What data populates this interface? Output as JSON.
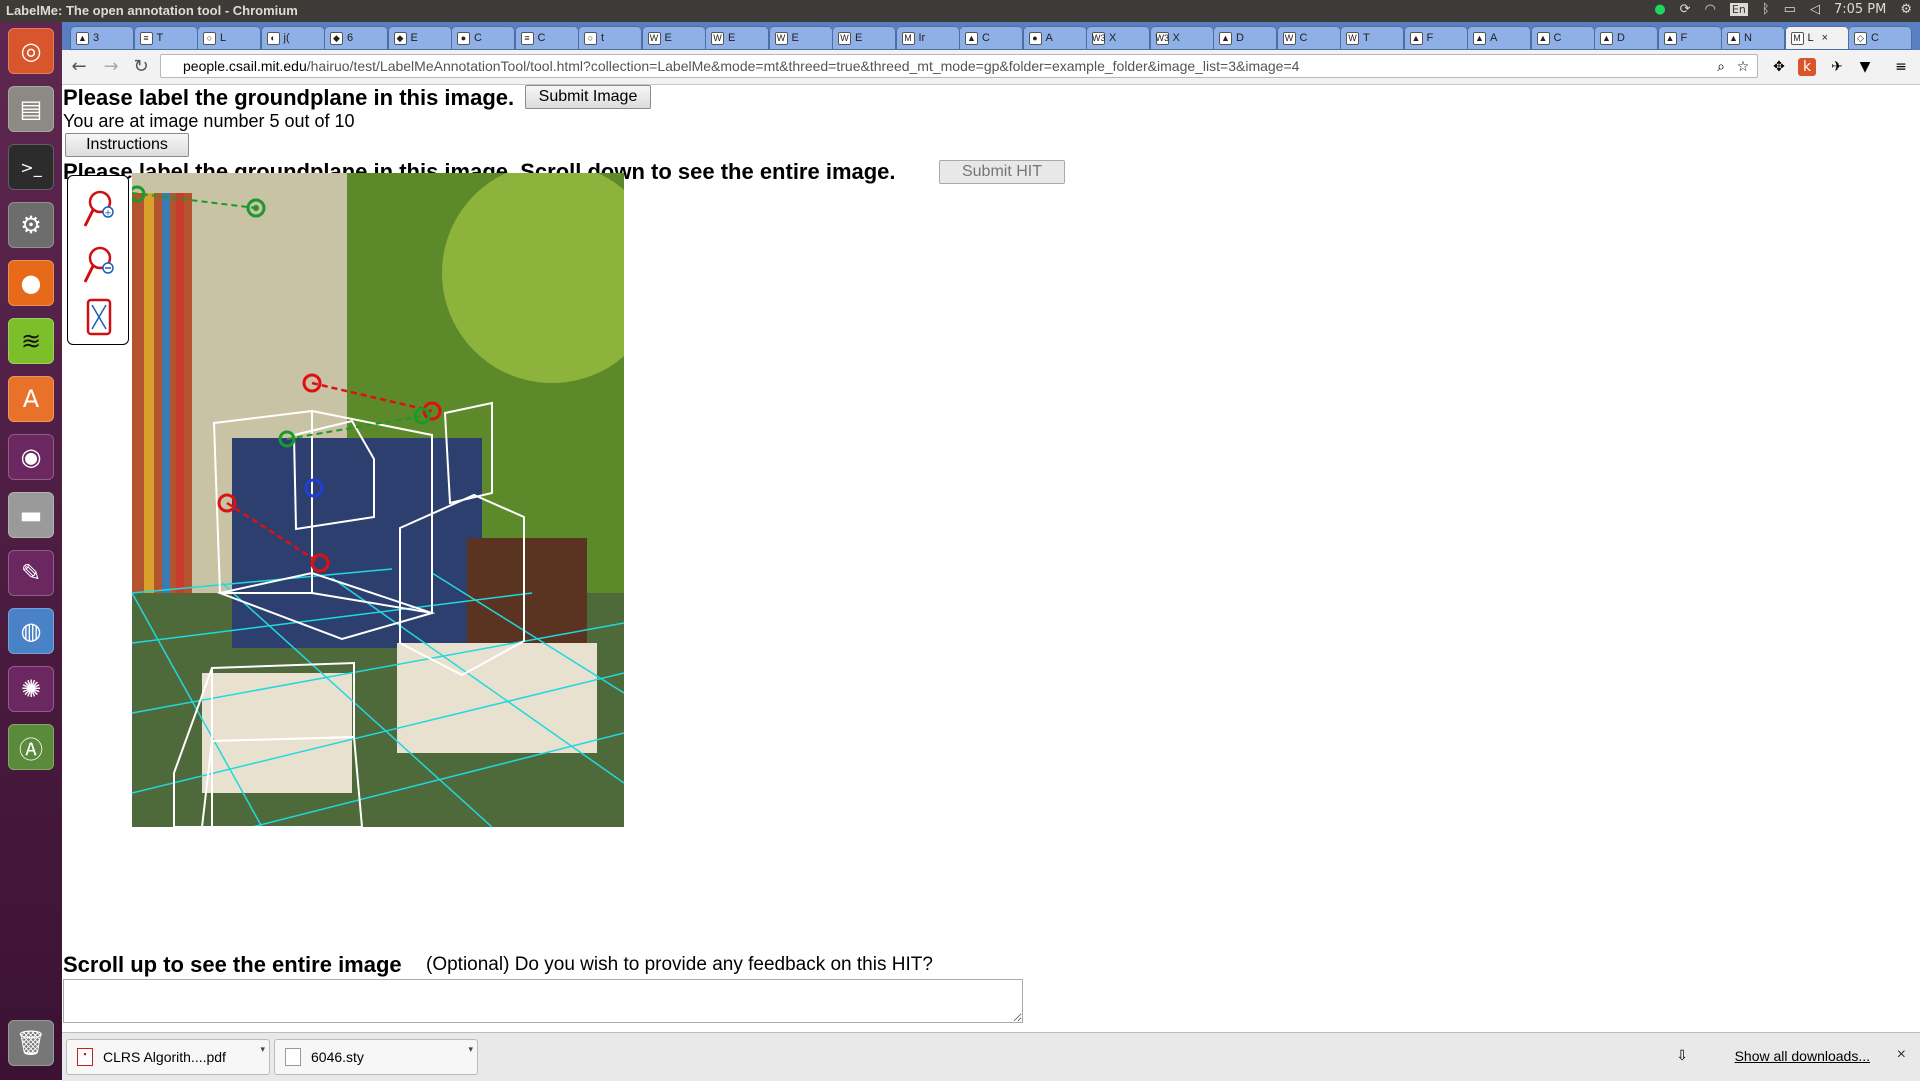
{
  "window": {
    "title": "LabelMe: The open annotation tool - Chromium"
  },
  "system_tray": {
    "keyboard": "En",
    "clock": "7:05 PM"
  },
  "launcher_items": [
    "ubuntu-dash",
    "files",
    "terminal",
    "system-settings",
    "firefox",
    "spotify",
    "software-center",
    "unity-tweak",
    "disk",
    "text-editor",
    "chromium",
    "gimp",
    "software-updater",
    "trash"
  ],
  "tabs": [
    {
      "label": "3",
      "fav": "▲"
    },
    {
      "label": "T",
      "fav": "≡"
    },
    {
      "label": "L",
      "fav": "○"
    },
    {
      "label": "j(",
      "fav": "◐"
    },
    {
      "label": "6",
      "fav": "◆"
    },
    {
      "label": "E",
      "fav": "◆"
    },
    {
      "label": "C",
      "fav": "●"
    },
    {
      "label": "C",
      "fav": "≡"
    },
    {
      "label": "t",
      "fav": "○"
    },
    {
      "label": "E",
      "fav": "W"
    },
    {
      "label": "E",
      "fav": "W"
    },
    {
      "label": "E",
      "fav": "W"
    },
    {
      "label": "E",
      "fav": "W"
    },
    {
      "label": "Ir",
      "fav": "M"
    },
    {
      "label": "C",
      "fav": "▲"
    },
    {
      "label": "A",
      "fav": "●"
    },
    {
      "label": "X",
      "fav": "W3"
    },
    {
      "label": "X",
      "fav": "W3"
    },
    {
      "label": "D",
      "fav": "▲"
    },
    {
      "label": "C",
      "fav": "W"
    },
    {
      "label": "T",
      "fav": "W"
    },
    {
      "label": "F",
      "fav": "▲"
    },
    {
      "label": "A",
      "fav": "▲"
    },
    {
      "label": "C",
      "fav": "▲"
    },
    {
      "label": "D",
      "fav": "▲"
    },
    {
      "label": "F",
      "fav": "▲"
    },
    {
      "label": "N",
      "fav": "▲"
    },
    {
      "label": "L",
      "fav": "M",
      "active": true
    },
    {
      "label": "C",
      "fav": "◇"
    }
  ],
  "address": {
    "host": "people.csail.mit.edu",
    "path": "/hairuo/test/LabelMeAnnotationTool/tool.html?collection=LabelMe&mode=mt&threed=true&threed_mt_mode=gp&folder=example_folder&image_list=3&image=4"
  },
  "page": {
    "heading": "Please label the groundplane in this image.",
    "submit_image": "Submit Image",
    "progress": "You are at image number 5 out of 10",
    "instructions": "Instructions",
    "heading2": "Please label the groundplane in this image. Scroll down to see the entire image.",
    "submit_hit": "Submit HIT",
    "scroll_up": "Scroll up to see the entire image",
    "feedback_question": "(Optional) Do you wish to provide any feedback on this HIT?",
    "feedback_value": ""
  },
  "tools": [
    "zoom-in-icon",
    "zoom-out-icon",
    "fit-image-icon"
  ],
  "downloads": [
    {
      "name": "CLRS Algorith....pdf",
      "kind": "pdf"
    },
    {
      "name": "6046.sty",
      "kind": "file"
    }
  ],
  "shelf": {
    "show_all": "Show all downloads...",
    "close": "×"
  },
  "colors": {
    "launcher": "#5e2750",
    "tabstrip": "#5a7fc0",
    "keypoint_red": "#e01010",
    "keypoint_green": "#1a9a2a",
    "grid_cyan": "#20d8e0"
  }
}
